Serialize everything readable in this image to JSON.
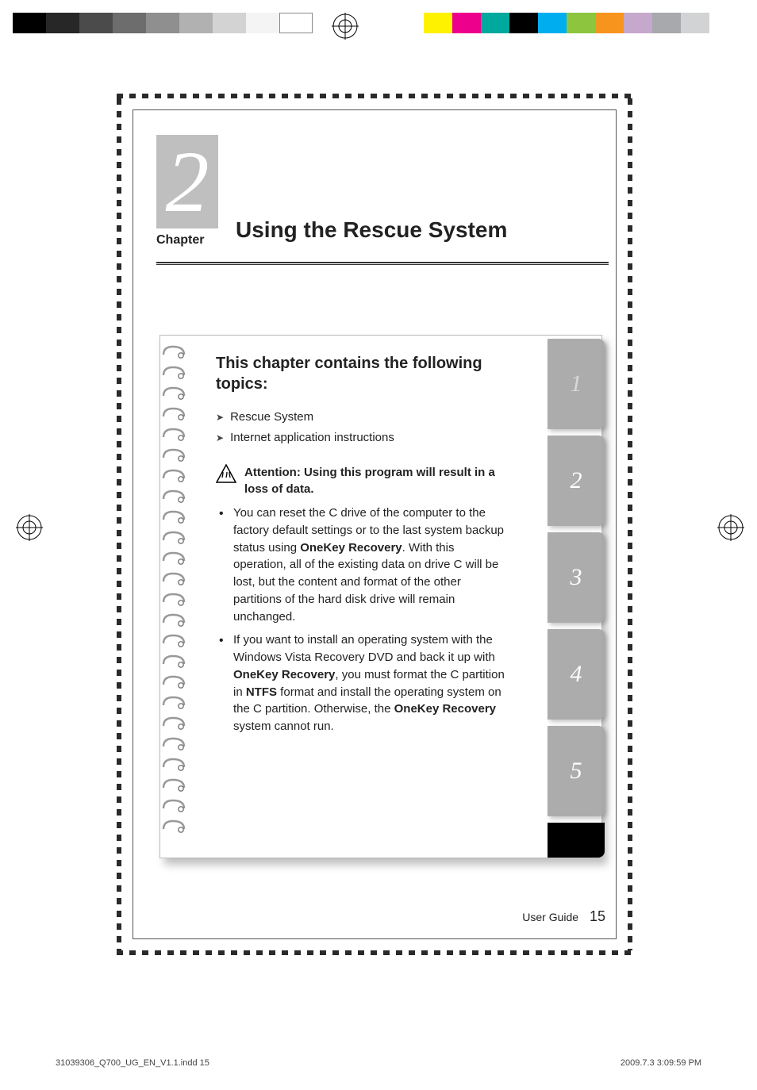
{
  "chapter": {
    "number": "2",
    "label": "Chapter",
    "title": "Using the Rescue System"
  },
  "panel": {
    "heading": "This chapter contains the following topics:",
    "topics": [
      "Rescue System",
      "Internet application instructions"
    ],
    "attention": "Attention: Using this program will result in a loss of data.",
    "bullets": [
      {
        "pre": "You can reset the C drive of the computer to the factory default settings or to the last system backup status using ",
        "b1": "OneKey Recovery",
        "post": ". With this operation, all of the existing data on drive C will be lost, but the content and format of the other partitions of the hard disk drive will remain unchanged."
      },
      {
        "pre": "If you want to install an operating system with the Windows Vista Recovery DVD and back it up with ",
        "b1": "OneKey Recovery",
        "mid": ", you must format the C partition in ",
        "b2": "NTFS",
        "mid2": " format and install the operating system on the C partition. Otherwise, the ",
        "b3": "OneKey Recovery",
        "post": " system cannot run."
      }
    ]
  },
  "tabs": [
    "1",
    "2",
    "3",
    "4",
    "5"
  ],
  "footer": {
    "label": "User Guide",
    "page": "15"
  },
  "imprint": {
    "file": "31039306_Q700_UG_EN_V1.1.indd   15",
    "datetime": "2009.7.3   3:09:59 PM"
  },
  "colors": {
    "bw": [
      "#000",
      "#272727",
      "#4b4b4b",
      "#6d6d6d",
      "#8f8f8f",
      "#b1b1b1",
      "#d3d3d3",
      "#f4f4f4",
      "#ffffff"
    ],
    "cmyk": [
      "#fff200",
      "#ec008c",
      "#00a99d",
      "#000000",
      "#00aeef",
      "#8dc63e",
      "#f7941e",
      "#c6a8cc",
      "#a7a9ac",
      "#d1d3d4"
    ]
  }
}
